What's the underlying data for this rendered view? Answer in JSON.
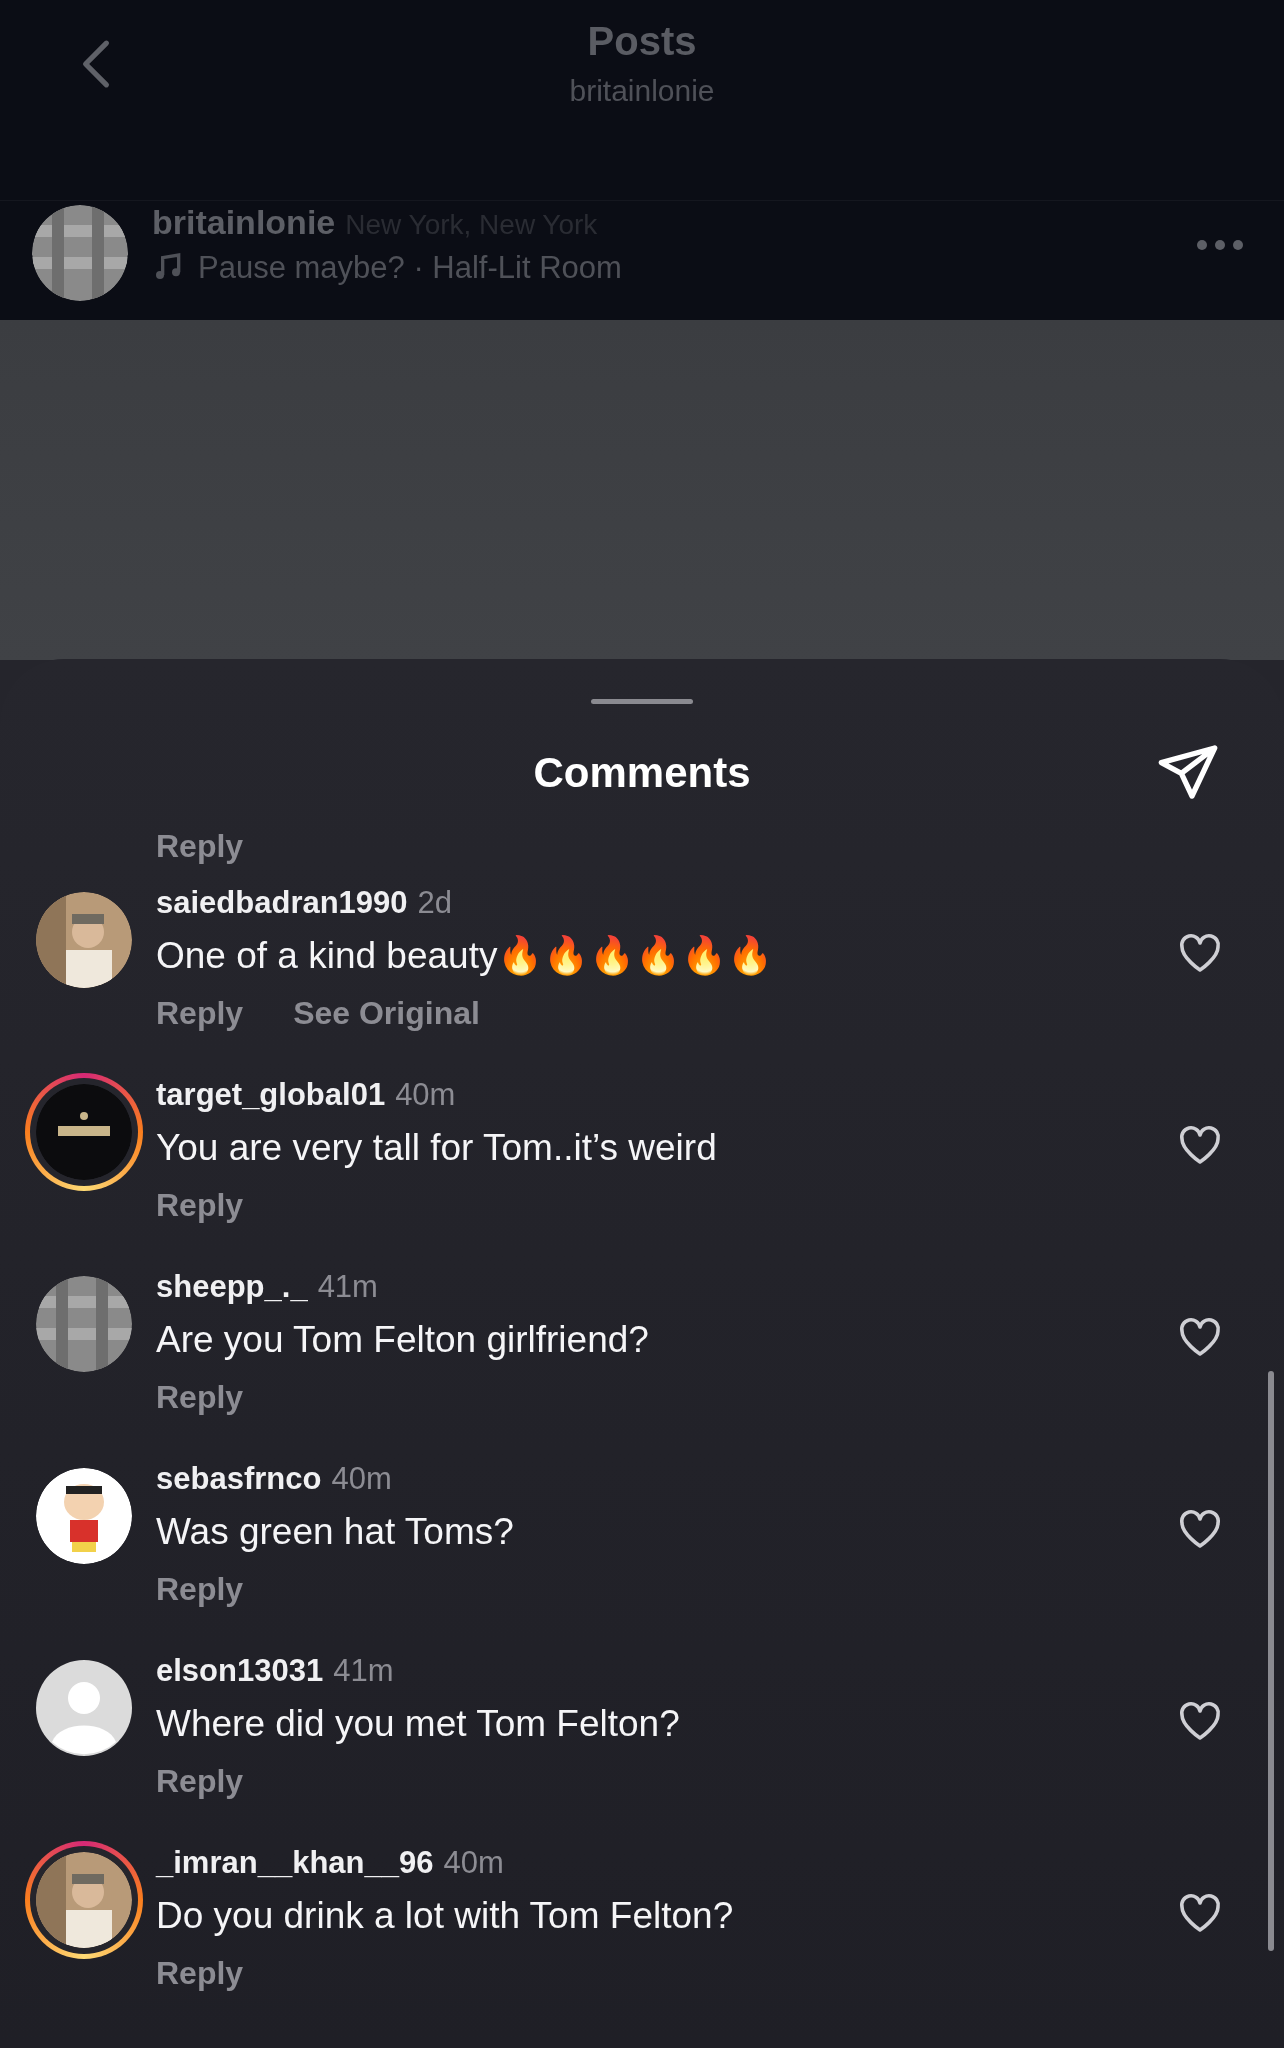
{
  "header": {
    "title": "Posts",
    "subtitle": "britainlonie"
  },
  "post": {
    "username": "britainlonie",
    "location": "New York, New York",
    "audio": "Pause maybe? · Half-Lit Room"
  },
  "sheet": {
    "title": "Comments",
    "cut_reply": "Reply"
  },
  "comments": [
    {
      "username": "saiedbadran1990",
      "time": "2d",
      "text": "One of a kind beauty🔥🔥🔥🔥🔥🔥",
      "avatar": {
        "kind": "picture"
      },
      "ring": false,
      "actions": [
        "Reply",
        "See Original"
      ]
    },
    {
      "username": "target_global01",
      "time": "40m",
      "text": "You are very tall for Tom..it’s weird",
      "avatar": {
        "kind": "picture"
      },
      "ring": true,
      "actions": [
        "Reply"
      ]
    },
    {
      "username": "sheepp_._",
      "time": "41m",
      "text": "Are you Tom Felton girlfriend?",
      "avatar": {
        "kind": "picture"
      },
      "ring": false,
      "actions": [
        "Reply"
      ]
    },
    {
      "username": "sebasfrnco",
      "time": "40m",
      "text": "Was green hat Toms?",
      "avatar": {
        "kind": "picture"
      },
      "ring": false,
      "actions": [
        "Reply"
      ]
    },
    {
      "username": "elson13031",
      "time": "41m",
      "text": "Where did you met Tom Felton?",
      "avatar": {
        "kind": "default"
      },
      "ring": false,
      "actions": [
        "Reply"
      ]
    },
    {
      "username": "_imran__khan__96",
      "time": "40m",
      "text": "Do you drink a lot with Tom Felton?",
      "avatar": {
        "kind": "picture"
      },
      "ring": true,
      "actions": [
        "Reply"
      ]
    }
  ]
}
